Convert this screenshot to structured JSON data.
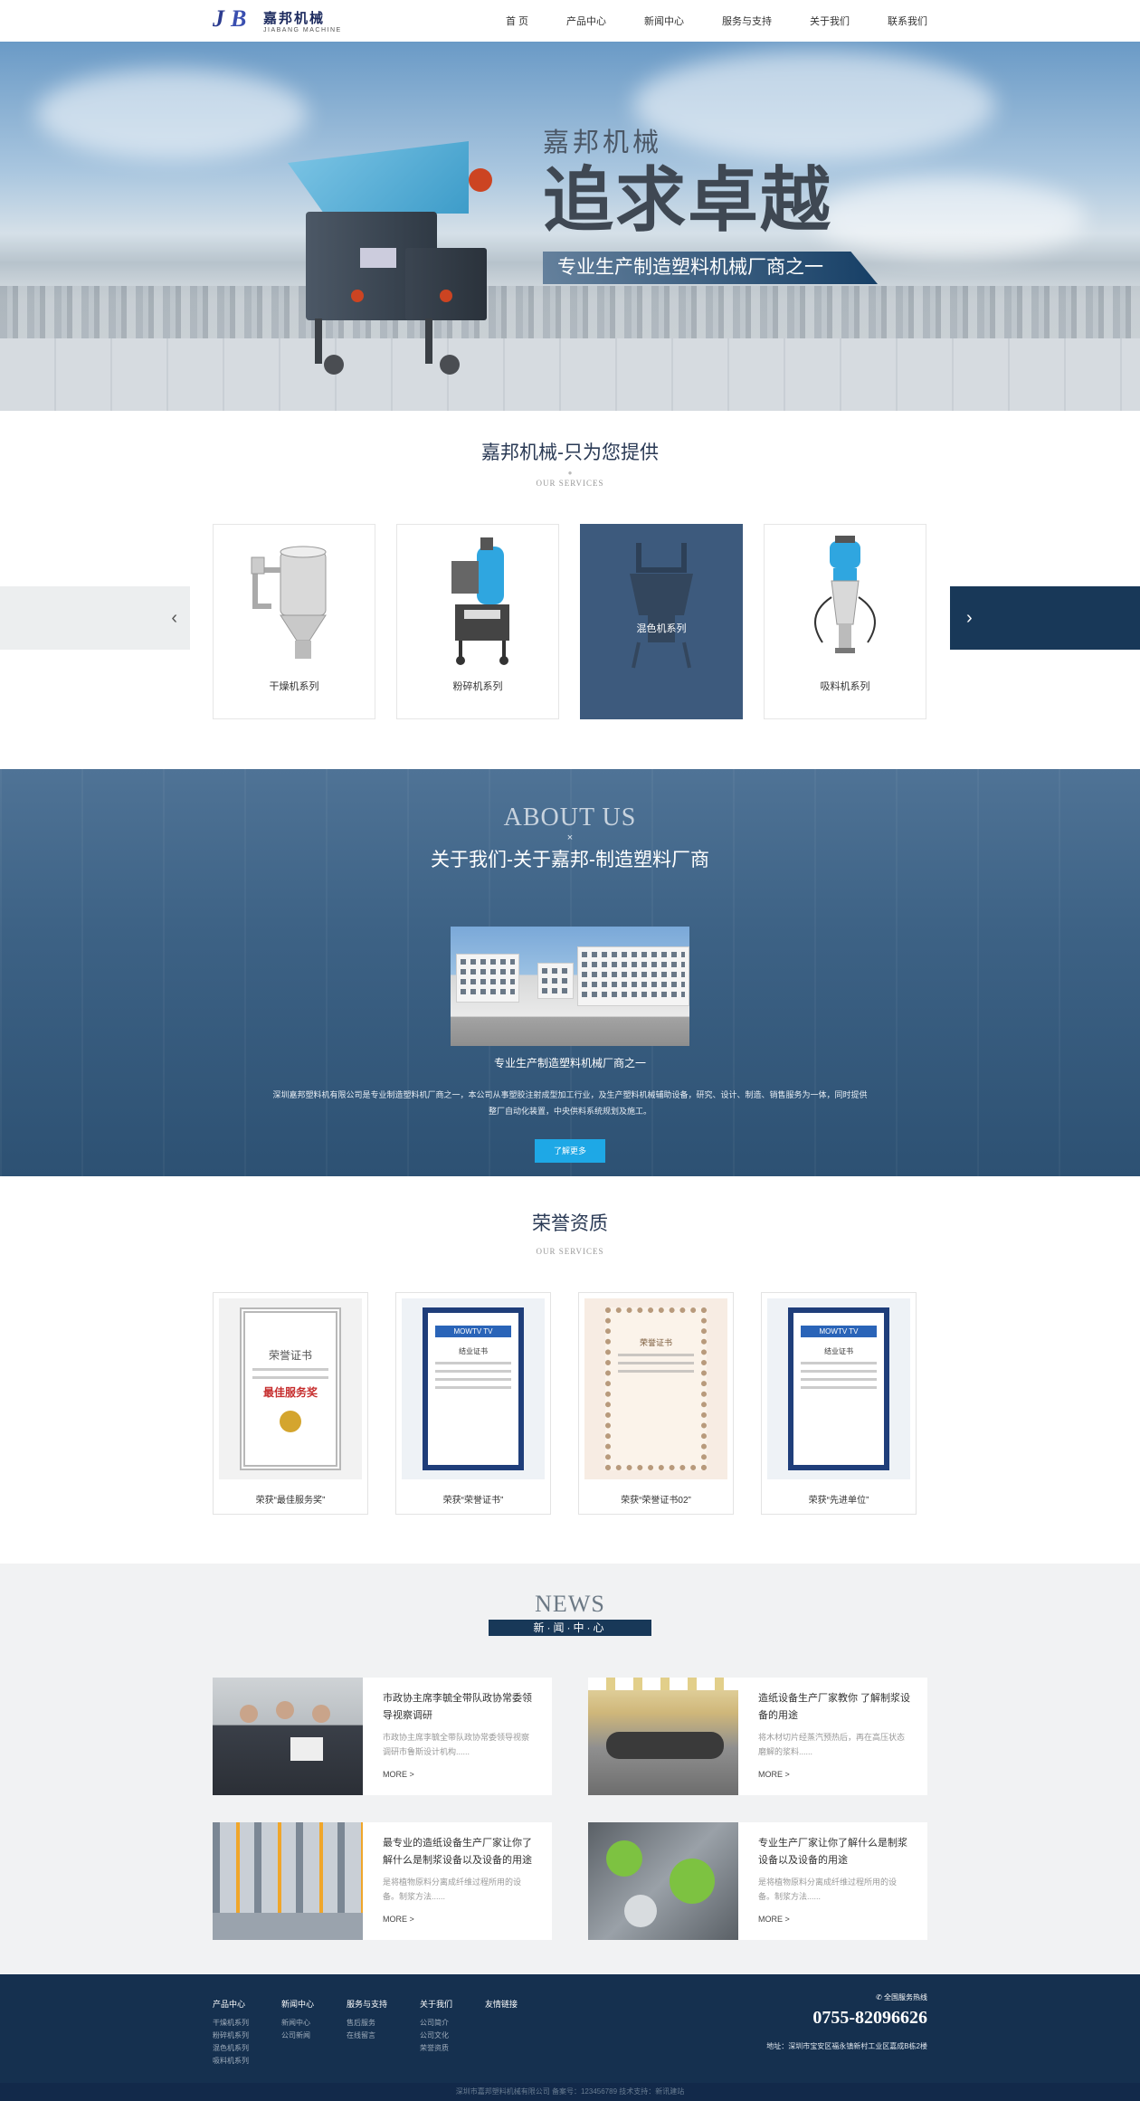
{
  "header": {
    "logo_cn": "嘉邦机械",
    "logo_en": "JIABANG MACHINE",
    "nav": [
      "首 页",
      "产品中心",
      "新闻中心",
      "服务与支持",
      "关于我们",
      "联系我们"
    ]
  },
  "banner": {
    "line1": "嘉邦机械",
    "line2": "追求卓越",
    "line3": "专业生产制造塑料机械厂商之一",
    "slide_count": 3,
    "active_slide": 1
  },
  "services": {
    "title": "嘉邦机械-只为您提供",
    "subtitle": "OUR SERVICES",
    "items": [
      {
        "label": "干燥机系列"
      },
      {
        "label": "粉碎机系列"
      },
      {
        "label": "混色机系列"
      },
      {
        "label": "吸料机系列"
      }
    ],
    "prev_icon": "‹",
    "next_icon": "›"
  },
  "about": {
    "title_en": "ABOUT US",
    "title_cn": "关于我们-关于嘉邦-制造塑料厂商",
    "caption": "专业生产制造塑料机械厂商之一",
    "desc": "深圳嘉邦塑料机有限公司是专业制造塑料机厂商之一，本公司从事塑胶注射成型加工行业，及生产塑料机械辅助设备，研究、设计、制造、销售服务为一体，同时提供整厂自动化装置，中央供料系统规划及施工。",
    "button": "了解更多"
  },
  "honors": {
    "title": "荣誉资质",
    "subtitle": "OUR SERVICES",
    "items": [
      {
        "label": "荣获“最佳服务奖”",
        "cert_title": "荣誉证书",
        "cert_award": "最佳服务奖"
      },
      {
        "label": "荣获“荣誉证书”",
        "cert_title": "MOWTV TV",
        "cert_award": "结业证书"
      },
      {
        "label": "荣获“荣誉证书02”",
        "cert_title": "荣誉证书",
        "cert_award": ""
      },
      {
        "label": "荣获“先进单位”",
        "cert_title": "MOWTV TV",
        "cert_award": "结业证书"
      }
    ]
  },
  "news": {
    "title_en": "NEWS",
    "title_cn": "新·闻·中·心",
    "items": [
      {
        "title": "市政协主席李毓全带队政协常委领导视察调研",
        "summary": "市政协主席李毓全带队政协常委领导视察调研市鲁斯设计机构......",
        "more": "MORE  >"
      },
      {
        "title": "造纸设备生产厂家教你 了解制浆设备的用途",
        "summary": "将木材切片经蒸汽预热后，再在高压状态磨解的浆料......",
        "more": "MORE  >"
      },
      {
        "title": "最专业的造纸设备生产厂家让你了解什么是制浆设备以及设备的用途",
        "summary": "是将植物原料分离成纤维过程所用的设备。制浆方法......",
        "more": "MORE  >"
      },
      {
        "title": "专业生产厂家让你了解什么是制浆设备以及设备的用途",
        "summary": "是将植物原料分离成纤维过程所用的设备。制浆方法......",
        "more": "MORE  >"
      }
    ]
  },
  "footer": {
    "columns": [
      {
        "title": "产品中心",
        "links": [
          "干燥机系列",
          "粉碎机系列",
          "混色机系列",
          "吸料机系列"
        ]
      },
      {
        "title": "新闻中心",
        "links": [
          "新闻中心",
          "公司新闻"
        ]
      },
      {
        "title": "服务与支持",
        "links": [
          "售后服务",
          "在线留言"
        ]
      },
      {
        "title": "关于我们",
        "links": [
          "公司简介",
          "公司文化",
          "荣誉资质"
        ]
      },
      {
        "title": "友情链接",
        "links": []
      }
    ],
    "hotline_label": "全国服务热线",
    "phone": "0755-82096626",
    "address": "地址：深圳市宝安区福永镇新村工业区嘉成B栋2楼",
    "copyright": "深圳市嘉邦塑料机械有限公司    备案号：123456789    技术支持：新讯建站"
  },
  "colors": {
    "navy": "#183858",
    "about_bg": "#3d6285",
    "button_blue": "#1ea8e6"
  }
}
